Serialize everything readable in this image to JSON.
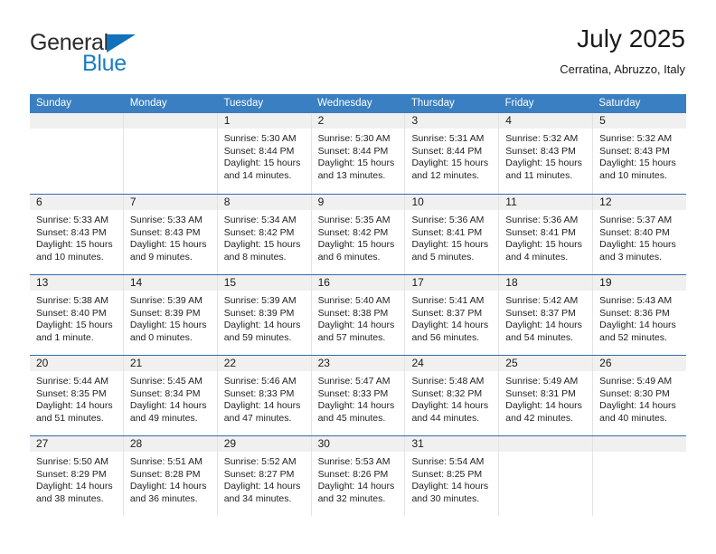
{
  "brand": {
    "name_part1": "General",
    "name_part2": "Blue",
    "triangle_color": "#1271bb",
    "blue_color": "#1a7ec4"
  },
  "header": {
    "title": "July 2025",
    "subtitle": "Cerratina, Abruzzo, Italy"
  },
  "theme": {
    "header_bar_color": "#3a7fc1",
    "week_border_color": "#2f6daf",
    "date_band_color": "#f0f0f0"
  },
  "weekdays": [
    "Sunday",
    "Monday",
    "Tuesday",
    "Wednesday",
    "Thursday",
    "Friday",
    "Saturday"
  ],
  "weeks": [
    [
      {
        "day": "",
        "sunrise": "",
        "sunset": "",
        "daylight": ""
      },
      {
        "day": "",
        "sunrise": "",
        "sunset": "",
        "daylight": ""
      },
      {
        "day": "1",
        "sunrise": "Sunrise: 5:30 AM",
        "sunset": "Sunset: 8:44 PM",
        "daylight": "Daylight: 15 hours and 14 minutes."
      },
      {
        "day": "2",
        "sunrise": "Sunrise: 5:30 AM",
        "sunset": "Sunset: 8:44 PM",
        "daylight": "Daylight: 15 hours and 13 minutes."
      },
      {
        "day": "3",
        "sunrise": "Sunrise: 5:31 AM",
        "sunset": "Sunset: 8:44 PM",
        "daylight": "Daylight: 15 hours and 12 minutes."
      },
      {
        "day": "4",
        "sunrise": "Sunrise: 5:32 AM",
        "sunset": "Sunset: 8:43 PM",
        "daylight": "Daylight: 15 hours and 11 minutes."
      },
      {
        "day": "5",
        "sunrise": "Sunrise: 5:32 AM",
        "sunset": "Sunset: 8:43 PM",
        "daylight": "Daylight: 15 hours and 10 minutes."
      }
    ],
    [
      {
        "day": "6",
        "sunrise": "Sunrise: 5:33 AM",
        "sunset": "Sunset: 8:43 PM",
        "daylight": "Daylight: 15 hours and 10 minutes."
      },
      {
        "day": "7",
        "sunrise": "Sunrise: 5:33 AM",
        "sunset": "Sunset: 8:43 PM",
        "daylight": "Daylight: 15 hours and 9 minutes."
      },
      {
        "day": "8",
        "sunrise": "Sunrise: 5:34 AM",
        "sunset": "Sunset: 8:42 PM",
        "daylight": "Daylight: 15 hours and 8 minutes."
      },
      {
        "day": "9",
        "sunrise": "Sunrise: 5:35 AM",
        "sunset": "Sunset: 8:42 PM",
        "daylight": "Daylight: 15 hours and 6 minutes."
      },
      {
        "day": "10",
        "sunrise": "Sunrise: 5:36 AM",
        "sunset": "Sunset: 8:41 PM",
        "daylight": "Daylight: 15 hours and 5 minutes."
      },
      {
        "day": "11",
        "sunrise": "Sunrise: 5:36 AM",
        "sunset": "Sunset: 8:41 PM",
        "daylight": "Daylight: 15 hours and 4 minutes."
      },
      {
        "day": "12",
        "sunrise": "Sunrise: 5:37 AM",
        "sunset": "Sunset: 8:40 PM",
        "daylight": "Daylight: 15 hours and 3 minutes."
      }
    ],
    [
      {
        "day": "13",
        "sunrise": "Sunrise: 5:38 AM",
        "sunset": "Sunset: 8:40 PM",
        "daylight": "Daylight: 15 hours and 1 minute."
      },
      {
        "day": "14",
        "sunrise": "Sunrise: 5:39 AM",
        "sunset": "Sunset: 8:39 PM",
        "daylight": "Daylight: 15 hours and 0 minutes."
      },
      {
        "day": "15",
        "sunrise": "Sunrise: 5:39 AM",
        "sunset": "Sunset: 8:39 PM",
        "daylight": "Daylight: 14 hours and 59 minutes."
      },
      {
        "day": "16",
        "sunrise": "Sunrise: 5:40 AM",
        "sunset": "Sunset: 8:38 PM",
        "daylight": "Daylight: 14 hours and 57 minutes."
      },
      {
        "day": "17",
        "sunrise": "Sunrise: 5:41 AM",
        "sunset": "Sunset: 8:37 PM",
        "daylight": "Daylight: 14 hours and 56 minutes."
      },
      {
        "day": "18",
        "sunrise": "Sunrise: 5:42 AM",
        "sunset": "Sunset: 8:37 PM",
        "daylight": "Daylight: 14 hours and 54 minutes."
      },
      {
        "day": "19",
        "sunrise": "Sunrise: 5:43 AM",
        "sunset": "Sunset: 8:36 PM",
        "daylight": "Daylight: 14 hours and 52 minutes."
      }
    ],
    [
      {
        "day": "20",
        "sunrise": "Sunrise: 5:44 AM",
        "sunset": "Sunset: 8:35 PM",
        "daylight": "Daylight: 14 hours and 51 minutes."
      },
      {
        "day": "21",
        "sunrise": "Sunrise: 5:45 AM",
        "sunset": "Sunset: 8:34 PM",
        "daylight": "Daylight: 14 hours and 49 minutes."
      },
      {
        "day": "22",
        "sunrise": "Sunrise: 5:46 AM",
        "sunset": "Sunset: 8:33 PM",
        "daylight": "Daylight: 14 hours and 47 minutes."
      },
      {
        "day": "23",
        "sunrise": "Sunrise: 5:47 AM",
        "sunset": "Sunset: 8:33 PM",
        "daylight": "Daylight: 14 hours and 45 minutes."
      },
      {
        "day": "24",
        "sunrise": "Sunrise: 5:48 AM",
        "sunset": "Sunset: 8:32 PM",
        "daylight": "Daylight: 14 hours and 44 minutes."
      },
      {
        "day": "25",
        "sunrise": "Sunrise: 5:49 AM",
        "sunset": "Sunset: 8:31 PM",
        "daylight": "Daylight: 14 hours and 42 minutes."
      },
      {
        "day": "26",
        "sunrise": "Sunrise: 5:49 AM",
        "sunset": "Sunset: 8:30 PM",
        "daylight": "Daylight: 14 hours and 40 minutes."
      }
    ],
    [
      {
        "day": "27",
        "sunrise": "Sunrise: 5:50 AM",
        "sunset": "Sunset: 8:29 PM",
        "daylight": "Daylight: 14 hours and 38 minutes."
      },
      {
        "day": "28",
        "sunrise": "Sunrise: 5:51 AM",
        "sunset": "Sunset: 8:28 PM",
        "daylight": "Daylight: 14 hours and 36 minutes."
      },
      {
        "day": "29",
        "sunrise": "Sunrise: 5:52 AM",
        "sunset": "Sunset: 8:27 PM",
        "daylight": "Daylight: 14 hours and 34 minutes."
      },
      {
        "day": "30",
        "sunrise": "Sunrise: 5:53 AM",
        "sunset": "Sunset: 8:26 PM",
        "daylight": "Daylight: 14 hours and 32 minutes."
      },
      {
        "day": "31",
        "sunrise": "Sunrise: 5:54 AM",
        "sunset": "Sunset: 8:25 PM",
        "daylight": "Daylight: 14 hours and 30 minutes."
      },
      {
        "day": "",
        "sunrise": "",
        "sunset": "",
        "daylight": ""
      },
      {
        "day": "",
        "sunrise": "",
        "sunset": "",
        "daylight": ""
      }
    ]
  ]
}
